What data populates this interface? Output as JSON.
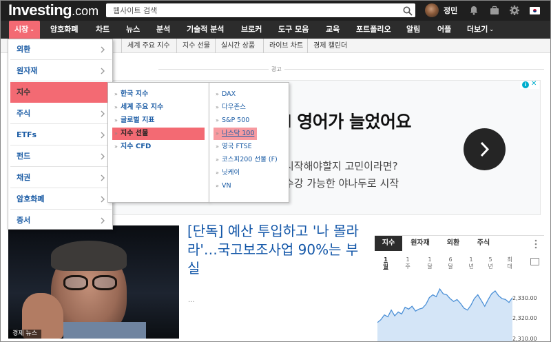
{
  "header": {
    "logo_main": "Investing",
    "logo_domain": ".com",
    "search_placeholder": "웹사이트 검색",
    "username": "정민"
  },
  "mainnav": {
    "items": [
      "시장",
      "암호화폐",
      "차트",
      "뉴스",
      "분석",
      "기술적 분석",
      "브로커",
      "도구 모음",
      "교육",
      "포트폴리오",
      "알림",
      "어플",
      "더보기"
    ],
    "active_index": 0
  },
  "subnav": {
    "items": [
      "세계 주요 지수",
      "지수 선물",
      "실시간 상품",
      "라이브 차트",
      "경제 캘린더"
    ]
  },
  "menu_level1": {
    "items": [
      "외환",
      "원자재",
      "지수",
      "주식",
      "ETFs",
      "펀드",
      "채권",
      "암호화폐",
      "증서"
    ],
    "highlight_index": 2
  },
  "menu_level2": {
    "items": [
      "한국 지수",
      "세계 주요 지수",
      "글로벌 지표",
      "지수 선물",
      "지수 CFD"
    ],
    "highlight_index": 3
  },
  "menu_level3": {
    "items": [
      "DAX",
      "다우존스",
      "S&P 500",
      "나스닥 100",
      "영국 FTSE",
      "코스피200 선물 (F)",
      "닛케이",
      "VN"
    ],
    "highlight_index": 3
  },
  "ad": {
    "label": "광고",
    "headline": "l 영어가 늘었어요",
    "line1": "시작해야할지 고민이라면?",
    "line2": "수강 가능한 야나두로 시작"
  },
  "news": {
    "caption": "경제 뉴스",
    "title": "[단독] 예산 투입하고 '나 몰라라'…국고보조사업 90%는 부실",
    "more": "..."
  },
  "widget": {
    "tabs": [
      "지수",
      "원자재",
      "외환",
      "주식"
    ],
    "active_tab": 0,
    "ranges": [
      [
        "1",
        "일"
      ],
      [
        "1",
        "주"
      ],
      [
        "1",
        "달"
      ],
      [
        "6",
        "달"
      ],
      [
        "1",
        "년"
      ],
      [
        "5",
        "년"
      ],
      [
        "최",
        "대"
      ]
    ],
    "active_range": 0,
    "y_labels": [
      "2,330.00",
      "2,320.00",
      "2,310.00"
    ],
    "chart_points": [
      2318.5,
      2320.0,
      2322.5,
      2321.5,
      2325.0,
      2322.0,
      2324.0,
      2323.0,
      2326.5,
      2325.5,
      2327.0,
      2324.5,
      2325.5,
      2326.0,
      2328.0,
      2331.5,
      2333.0,
      2332.0,
      2336.0,
      2333.5,
      2333.0,
      2331.0,
      2329.5,
      2330.5,
      2328.5,
      2326.0,
      2325.0,
      2327.5,
      2331.0,
      2333.0,
      2330.0,
      2327.0,
      2330.5,
      2333.5,
      2335.0,
      2332.5,
      2331.0,
      2330.5,
      2329.0,
      2331.5
    ],
    "y_min": 2308,
    "y_max": 2340,
    "colors": {
      "line": "#4a8fd6",
      "fill": "#d4e5f7"
    }
  },
  "colors": {
    "accent": "#f36a73",
    "link": "#1a5ba4",
    "topbar": "#1f1f1f",
    "nav": "#2c2c2c"
  }
}
